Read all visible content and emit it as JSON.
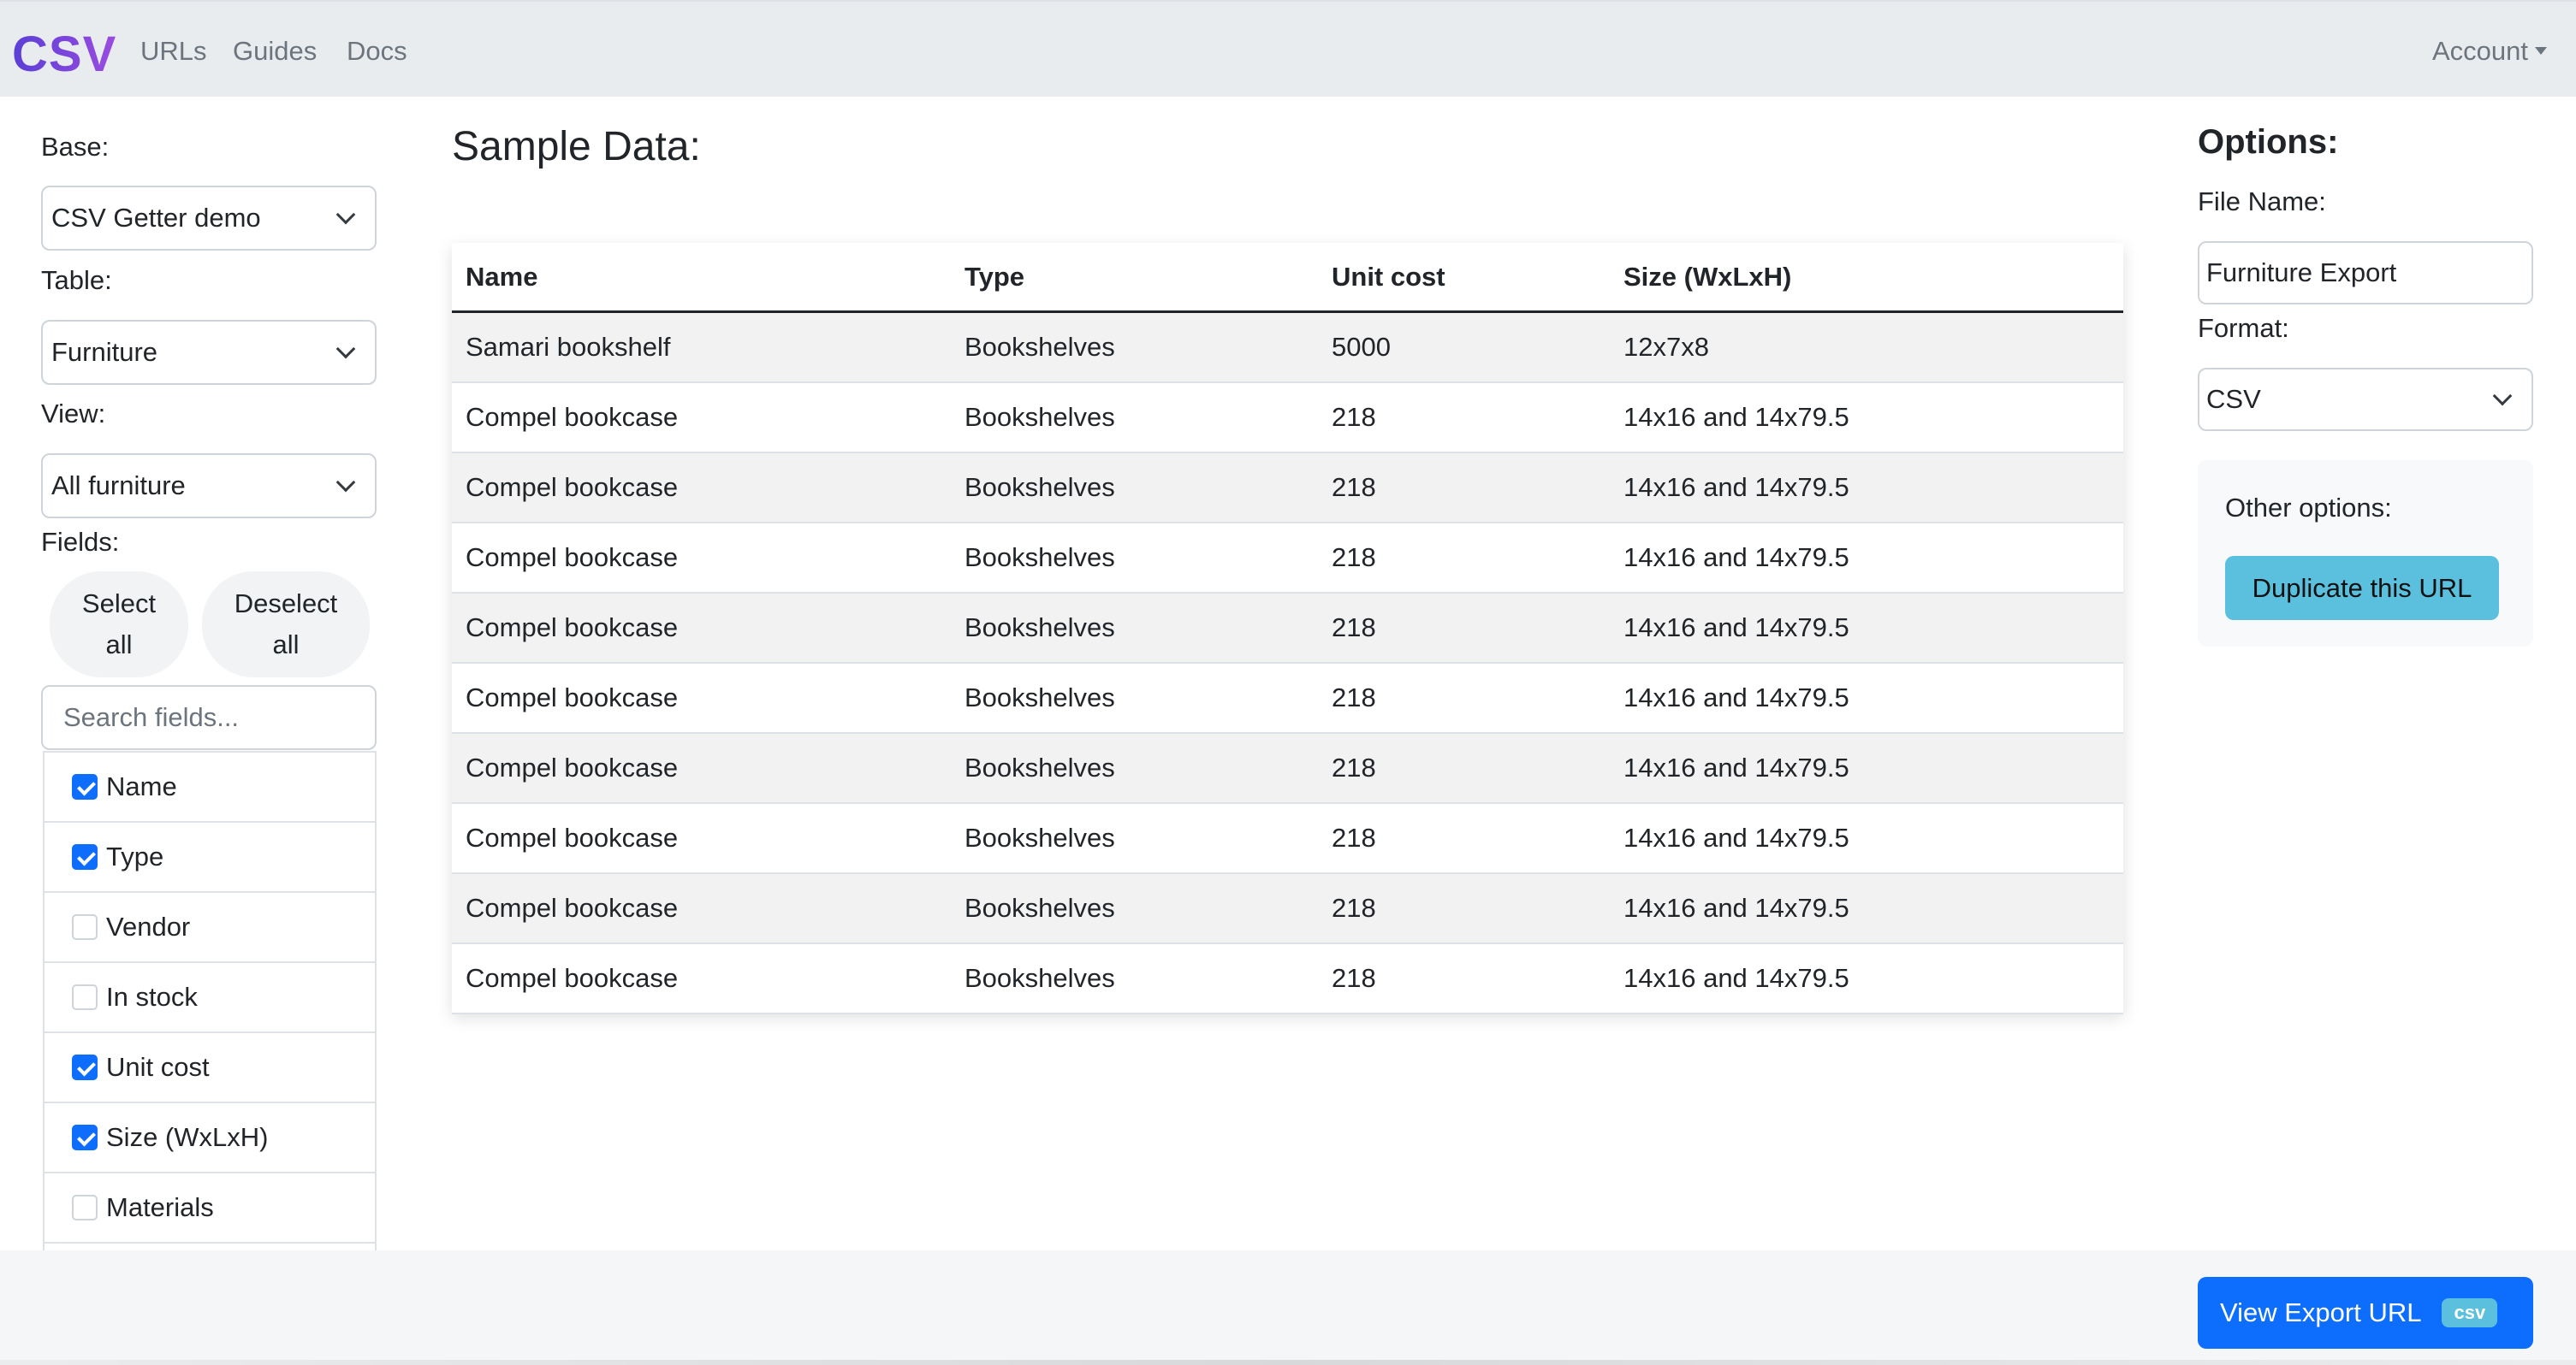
{
  "navbar": {
    "brand": "CSV",
    "links": [
      "URLs",
      "Guides",
      "Docs"
    ],
    "account": "Account"
  },
  "sidebar": {
    "base_label": "Base:",
    "base_value": "CSV Getter demo",
    "table_label": "Table:",
    "table_value": "Furniture",
    "view_label": "View:",
    "view_value": "All furniture",
    "fields_label": "Fields:",
    "select_all_line1": "Select",
    "select_all_line2": "all",
    "deselect_all_line1": "Deselect",
    "deselect_all_line2": "all",
    "search_placeholder": "Search fields...",
    "fields": [
      {
        "label": "Name",
        "checked": true
      },
      {
        "label": "Type",
        "checked": true
      },
      {
        "label": "Vendor",
        "checked": false
      },
      {
        "label": "In stock",
        "checked": false
      },
      {
        "label": "Unit cost",
        "checked": true
      },
      {
        "label": "Size (WxLxH)",
        "checked": true
      },
      {
        "label": "Materials",
        "checked": false
      }
    ]
  },
  "main": {
    "title": "Sample Data:",
    "columns": [
      "Name",
      "Type",
      "Unit cost",
      "Size (WxLxH)"
    ],
    "rows": [
      [
        "Samari bookshelf",
        "Bookshelves",
        "5000",
        "12x7x8"
      ],
      [
        "Compel bookcase",
        "Bookshelves",
        "218",
        "14x16 and 14x79.5"
      ],
      [
        "Compel bookcase",
        "Bookshelves",
        "218",
        "14x16 and 14x79.5"
      ],
      [
        "Compel bookcase",
        "Bookshelves",
        "218",
        "14x16 and 14x79.5"
      ],
      [
        "Compel bookcase",
        "Bookshelves",
        "218",
        "14x16 and 14x79.5"
      ],
      [
        "Compel bookcase",
        "Bookshelves",
        "218",
        "14x16 and 14x79.5"
      ],
      [
        "Compel bookcase",
        "Bookshelves",
        "218",
        "14x16 and 14x79.5"
      ],
      [
        "Compel bookcase",
        "Bookshelves",
        "218",
        "14x16 and 14x79.5"
      ],
      [
        "Compel bookcase",
        "Bookshelves",
        "218",
        "14x16 and 14x79.5"
      ],
      [
        "Compel bookcase",
        "Bookshelves",
        "218",
        "14x16 and 14x79.5"
      ]
    ]
  },
  "options": {
    "title": "Options:",
    "file_name_label": "File Name:",
    "file_name_value": "Furniture Export",
    "format_label": "Format:",
    "format_value": "CSV",
    "other_label": "Other options:",
    "duplicate_label": "Duplicate this URL"
  },
  "footer": {
    "export_label": "View Export URL",
    "export_badge": "csv"
  },
  "colors": {
    "brand": "#7048e8",
    "primary": "#0d6efd",
    "info": "#5bc0de",
    "navbar_bg": "#e9ecef"
  }
}
